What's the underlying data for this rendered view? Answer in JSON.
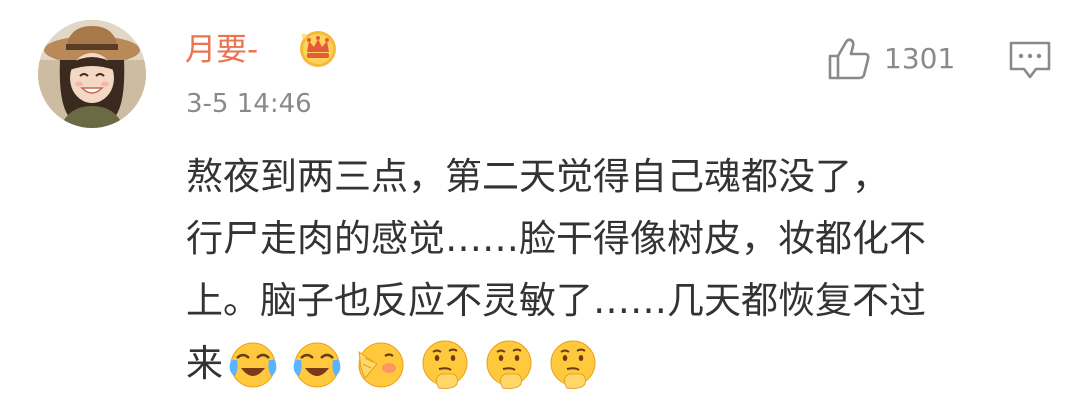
{
  "comment": {
    "username": "月要-",
    "timestamp": "3-5 14:46",
    "likes": "1301",
    "body_lines": [
      "熬夜到两三点，第二天觉得自己魂都没了，",
      "行尸走肉的感觉……脸干得像树皮，妆都化不",
      "上。脑子也反应不灵敏了……几天都恢复不过"
    ],
    "last_line_text": "来",
    "emojis": [
      "laugh-cry-emoji",
      "laugh-cry-emoji",
      "shy-face-emoji",
      "thinking-emoji",
      "thinking-emoji",
      "thinking-emoji"
    ]
  },
  "colors": {
    "username": "#eb7350",
    "meta_gray": "#8a8a8a",
    "body_text": "#333333",
    "vip_gold": "#f6b93b"
  },
  "icons": [
    "avatar",
    "vip-crown-icon",
    "thumbs-up-icon",
    "reply-icon"
  ]
}
